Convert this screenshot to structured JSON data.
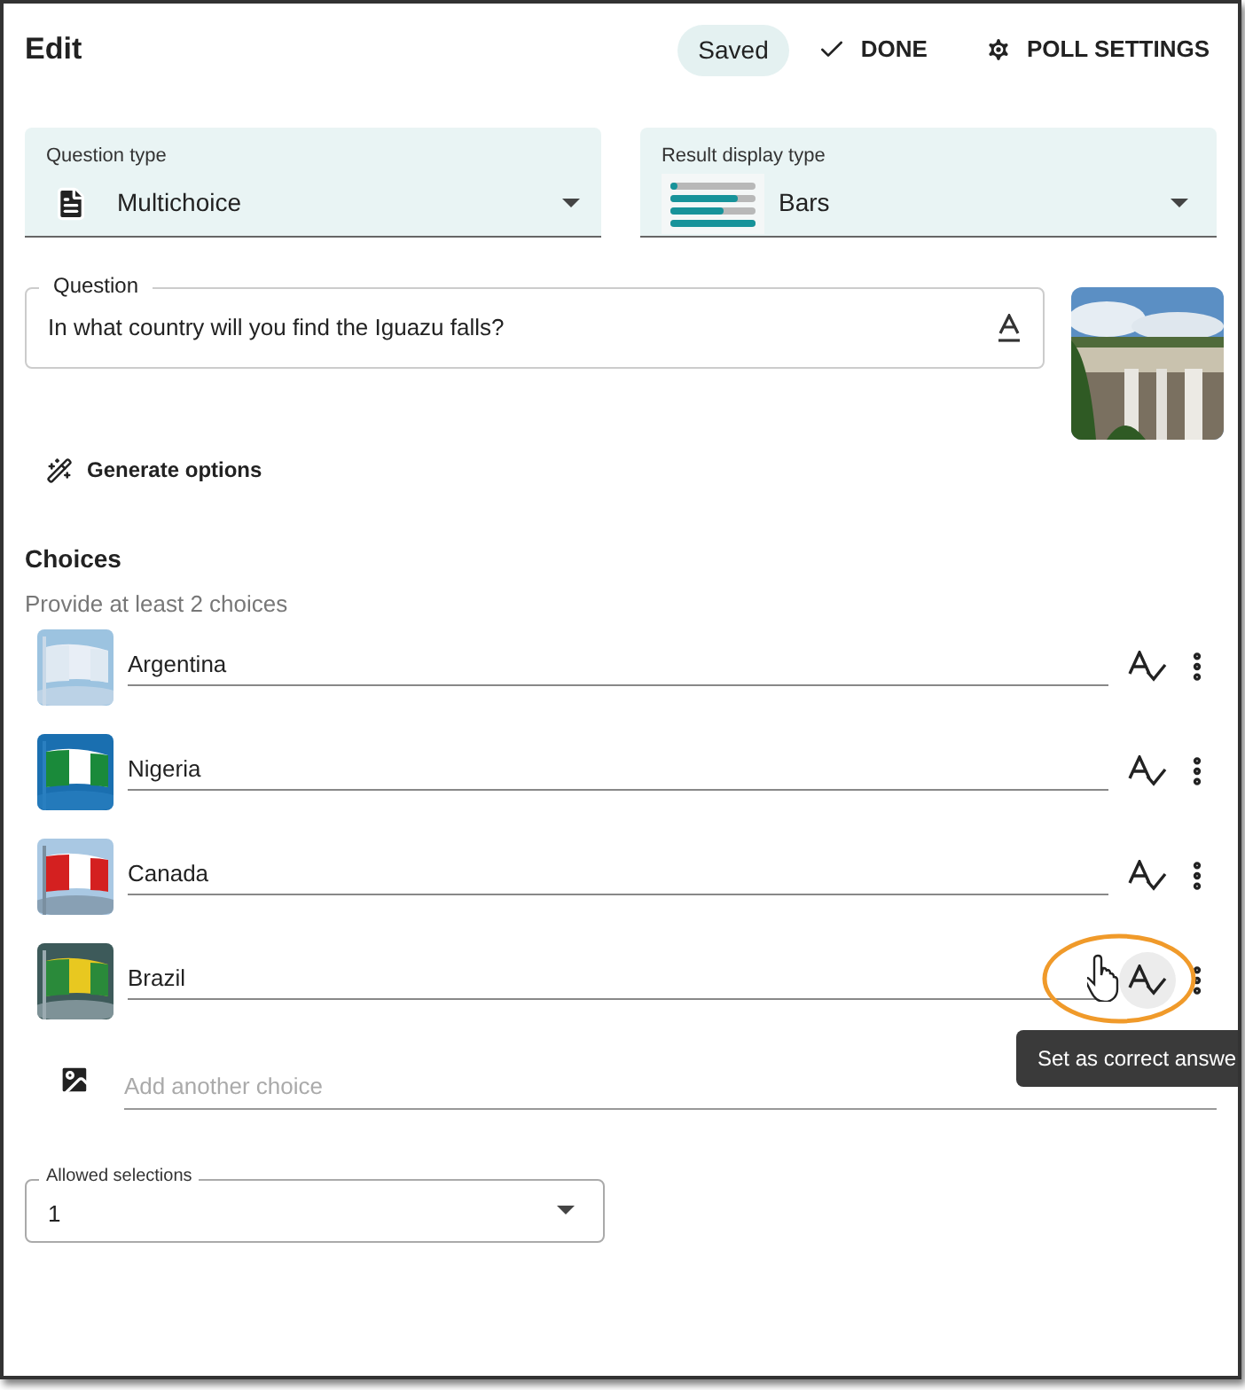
{
  "header": {
    "title": "Edit",
    "status": "Saved",
    "done": "DONE",
    "settings": "POLL SETTINGS"
  },
  "question_type": {
    "label": "Question type",
    "value": "Multichoice"
  },
  "result_display_type": {
    "label": "Result display type",
    "value": "Bars"
  },
  "question": {
    "label": "Question",
    "value": "In what country will you find the Iguazu falls?"
  },
  "generate": "Generate options",
  "choices": {
    "title": "Choices",
    "hint": "Provide at least 2 choices",
    "items": [
      {
        "text": "Argentina",
        "hovered": false
      },
      {
        "text": "Nigeria",
        "hovered": false
      },
      {
        "text": "Canada",
        "hovered": false
      },
      {
        "text": "Brazil",
        "hovered": true
      }
    ],
    "add": {
      "placeholder": "Add another choice"
    }
  },
  "tooltip": "Set as correct answe",
  "allowed_selections": {
    "label": "Allowed selections",
    "value": "1"
  }
}
